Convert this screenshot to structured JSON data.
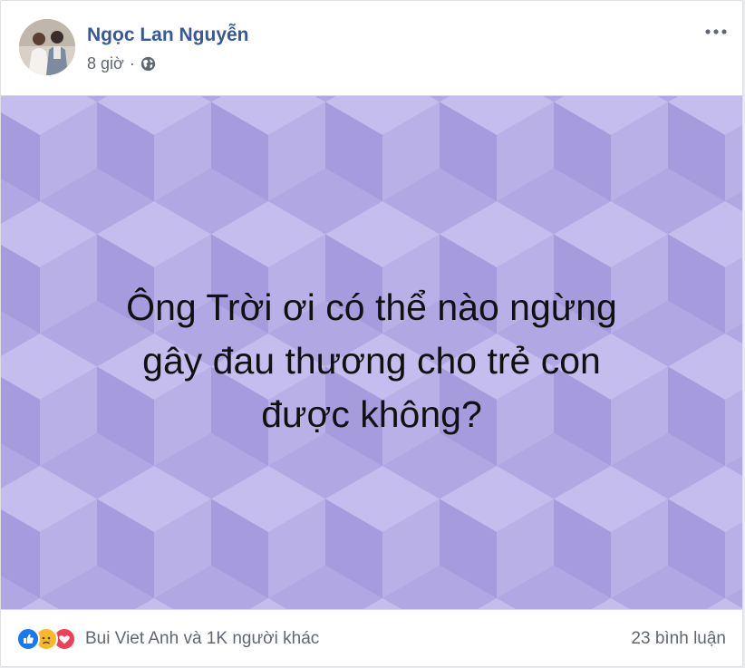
{
  "post": {
    "author": "Ngọc Lan Nguyễn",
    "time": "8 giờ",
    "separator": "·",
    "privacy_icon": "globe-icon",
    "more_icon": "more-options-icon",
    "text_lines": [
      "Ông Trời ơi có thể nào ngừng",
      "gây đau thương cho trẻ con",
      "được không?"
    ],
    "background_color": "#b3a9e3"
  },
  "footer": {
    "reaction_icons": [
      "like-icon",
      "sad-icon",
      "love-icon"
    ],
    "reactions_text": "Bui Viet Anh và 1K người khác",
    "comments_text": "23 bình luận"
  },
  "colors": {
    "author_link": "#385898",
    "secondary_text": "#606770",
    "like": "#1877f2",
    "sad": "#f7b928",
    "love": "#f33e58"
  }
}
